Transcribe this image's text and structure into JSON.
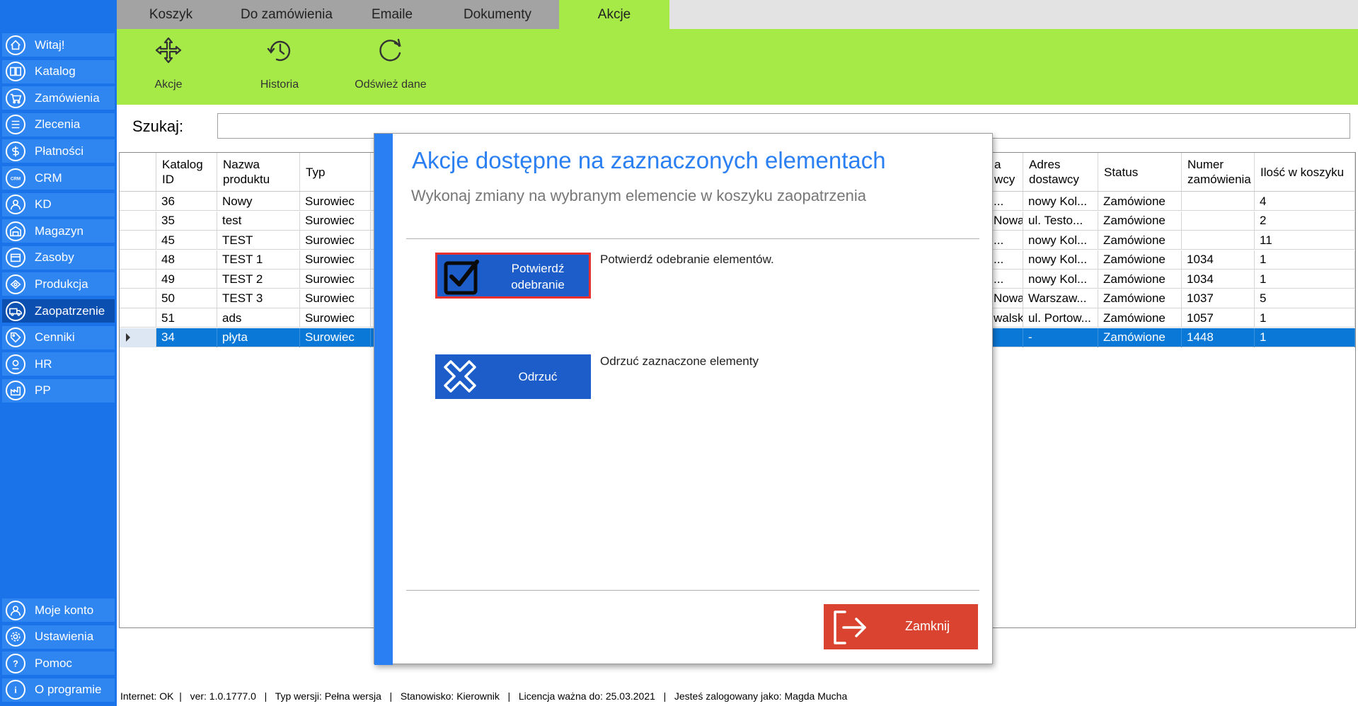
{
  "sidebar": {
    "top_items": [
      {
        "label": "Witaj!",
        "icon": "home-icon"
      },
      {
        "label": "Katalog",
        "icon": "book-icon"
      },
      {
        "label": "Zamówienia",
        "icon": "cart-icon"
      },
      {
        "label": "Zlecenia",
        "icon": "list-icon"
      },
      {
        "label": "Płatności",
        "icon": "dollar-icon"
      },
      {
        "label": "CRM",
        "icon": "crm-icon"
      },
      {
        "label": "KD",
        "icon": "user-icon"
      },
      {
        "label": "Magazyn",
        "icon": "warehouse-icon"
      },
      {
        "label": "Zasoby",
        "icon": "box-icon"
      },
      {
        "label": "Produkcja",
        "icon": "factory-icon"
      },
      {
        "label": "Zaopatrzenie",
        "icon": "truck-icon"
      },
      {
        "label": "Cenniki",
        "icon": "tag-icon"
      },
      {
        "label": "HR",
        "icon": "hr-icon"
      },
      {
        "label": "PP",
        "icon": "pp-icon"
      }
    ],
    "bottom_items": [
      {
        "label": "Moje konto",
        "icon": "user-account-icon"
      },
      {
        "label": "Ustawienia",
        "icon": "gear-icon"
      },
      {
        "label": "Pomoc",
        "icon": "help-icon"
      },
      {
        "label": "O programie",
        "icon": "info-icon"
      }
    ],
    "active": "Zaopatrzenie"
  },
  "tabs": {
    "koszyk": "Koszyk",
    "do_zamowienia": "Do zamówienia",
    "emaile": "Emaile",
    "dokumenty": "Dokumenty",
    "akcje": "Akcje",
    "active": "Akcje"
  },
  "ribbon": {
    "akcje": "Akcje",
    "historia": "Historia",
    "odswiez": "Odśwież dane"
  },
  "search": {
    "label": "Szukaj:",
    "value": ""
  },
  "grid": {
    "headers": {
      "katalog_id": "Katalog ID",
      "nazwa": "Nazwa produktu",
      "typ": "Typ",
      "dostawca_fragment": "a\nwcy",
      "adres": "Adres dostawcy",
      "status": "Status",
      "numer": "Numer zamówienia",
      "ilosc": "Ilość w koszyku"
    },
    "rows": [
      {
        "id": "36",
        "nazwa": "Nowy",
        "typ": "Surowiec",
        "dostawca": "...",
        "adres": "nowy Kol...",
        "status": "Zamówione",
        "numer": "",
        "ilosc": "4"
      },
      {
        "id": "35",
        "nazwa": "test",
        "typ": "Surowiec",
        "dostawca": "Nowak",
        "adres": "ul. Testo...",
        "status": "Zamówione",
        "numer": "",
        "ilosc": "2"
      },
      {
        "id": "45",
        "nazwa": "TEST",
        "typ": "Surowiec",
        "dostawca": "...",
        "adres": "nowy Kol...",
        "status": "Zamówione",
        "numer": "",
        "ilosc": "11"
      },
      {
        "id": "48",
        "nazwa": "TEST 1",
        "typ": "Surowiec",
        "dostawca": "...",
        "adres": "nowy Kol...",
        "status": "Zamówione",
        "numer": "1034",
        "ilosc": "1"
      },
      {
        "id": "49",
        "nazwa": "TEST 2",
        "typ": "Surowiec",
        "dostawca": "...",
        "adres": "nowy Kol...",
        "status": "Zamówione",
        "numer": "1034",
        "ilosc": "1"
      },
      {
        "id": "50",
        "nazwa": "TEST 3",
        "typ": "Surowiec",
        "dostawca": "Nowak",
        "adres": "Warszaw...",
        "status": "Zamówione",
        "numer": "1037",
        "ilosc": "5"
      },
      {
        "id": "51",
        "nazwa": "ads",
        "typ": "Surowiec",
        "dostawca": "walski",
        "adres": "ul. Portow...",
        "status": "Zamówione",
        "numer": "1057",
        "ilosc": "1"
      },
      {
        "id": "34",
        "nazwa": "płyta",
        "typ": "Surowiec",
        "dostawca": "",
        "adres": "-",
        "status": "Zamówione",
        "numer": "1448",
        "ilosc": "1"
      }
    ],
    "selected_row": 7
  },
  "modal": {
    "title": "Akcje dostępne na zaznaczonych elementach",
    "subtitle": "Wykonaj zmiany na wybranym elemencie w koszyku zaopatrzenia",
    "confirm_label": "Potwierdź odebranie",
    "confirm_desc": "Potwierdź odebranie elementów.",
    "reject_label": "Odrzuć",
    "reject_desc": "Odrzuć zaznaczone elementy",
    "close_label": "Zamknij"
  },
  "statusbar": {
    "text": "Internet: OK  |   ver: 1.0.1777.0   |   Typ wersji: Pełna wersja   |   Stanowisko: Kierownik   |   Licencja ważna do: 25.03.2021   |   Jesteś zalogowany jako: Magda Mucha"
  },
  "colors": {
    "sidebar_bg": "#1a73e8",
    "nav_item": "#2f86f0",
    "nav_active": "#0b4fb0",
    "ribbon": "#a6ea47",
    "accent_blue": "#2a7ff2",
    "selected_row": "#0a78d7",
    "close_red": "#d9432f"
  }
}
